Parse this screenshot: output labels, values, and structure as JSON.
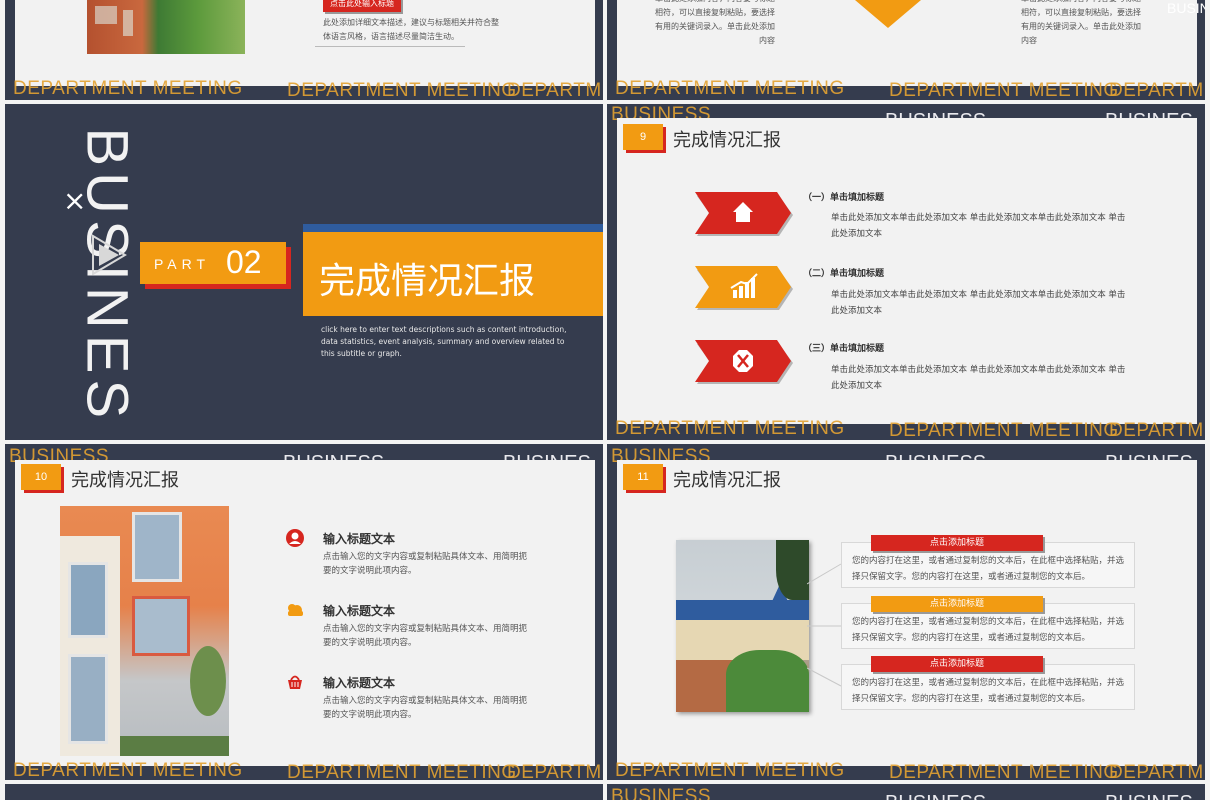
{
  "colors": {
    "navy": "#353c4e",
    "orange": "#f29b12",
    "red": "#d6261f",
    "blue": "#2f5c9e",
    "card": "#f2f2f2"
  },
  "watermark": {
    "department": "DEPARTMENT MEETING",
    "department_cut": "DEPARTME",
    "business": "BUSINESS",
    "business_cut": "BUSINES",
    "vertical_business": "BUSINES"
  },
  "slide_top_left": {
    "tag_label": "点击此处输入标题",
    "text": "此处添加详细文本描述，建议与标题相关并符合整体语言风格，语言描述尽量简洁生动。"
  },
  "slide_top_right": {
    "left_text": "单击此处添加内容，内容要与标题相符，可以直接复制粘贴，要选择有用的关键词录入。单击此处添加内容",
    "right_text": "单击此处添加内容，内容要与标题相符，可以直接复制粘贴，要选择有用的关键词录入。单击此处添加内容"
  },
  "slide_part": {
    "close_glyph": "×",
    "part_label": "PART",
    "part_number": "02",
    "title": "完成情况汇报",
    "description": "click here to enter text descriptions such as content introduction, data statistics, event analysis, summary and overview related to this subtitle or graph."
  },
  "slide_9": {
    "number": "9",
    "title": "完成情况汇报",
    "items": [
      {
        "icon": "home-icon",
        "title": "（一）单击填加标题",
        "text": "单击此处添加文本单击此处添加文本 单击此处添加文本单击此处添加文本 单击此处添加文本"
      },
      {
        "icon": "chart-icon",
        "title": "（二）单击填加标题",
        "text": "单击此处添加文本单击此处添加文本 单击此处添加文本单击此处添加文本 单击此处添加文本"
      },
      {
        "icon": "tools-icon",
        "title": "（三）单击填加标题",
        "text": "单击此处添加文本单击此处添加文本 单击此处添加文本单击此处添加文本 单击此处添加文本"
      }
    ]
  },
  "slide_10": {
    "number": "10",
    "title": "完成情况汇报",
    "items": [
      {
        "icon": "user-icon",
        "title": "输入标题文本",
        "text": "点击输入您的文字内容或复制粘贴具体文本、用简明扼要的文字说明此项内容。"
      },
      {
        "icon": "cloud-icon",
        "title": "输入标题文本",
        "text": "点击输入您的文字内容或复制粘贴具体文本、用简明扼要的文字说明此项内容。"
      },
      {
        "icon": "basket-icon",
        "title": "输入标题文本",
        "text": "点击输入您的文字内容或复制粘贴具体文本、用简明扼要的文字说明此项内容。"
      }
    ]
  },
  "slide_11": {
    "number": "11",
    "title": "完成情况汇报",
    "items": [
      {
        "tag": "点击添加标题",
        "text": "您的内容打在这里，或者通过复制您的文本后，在此框中选择粘贴，并选择只保留文字。您的内容打在这里，或者通过复制您的文本后。"
      },
      {
        "tag": "点击添加标题",
        "text": "您的内容打在这里，或者通过复制您的文本后，在此框中选择粘贴，并选择只保留文字。您的内容打在这里，或者通过复制您的文本后。"
      },
      {
        "tag": "点击添加标题",
        "text": "您的内容打在这里，或者通过复制您的文本后，在此框中选择粘贴，并选择只保留文字。您的内容打在这里，或者通过复制您的文本后。"
      }
    ]
  }
}
